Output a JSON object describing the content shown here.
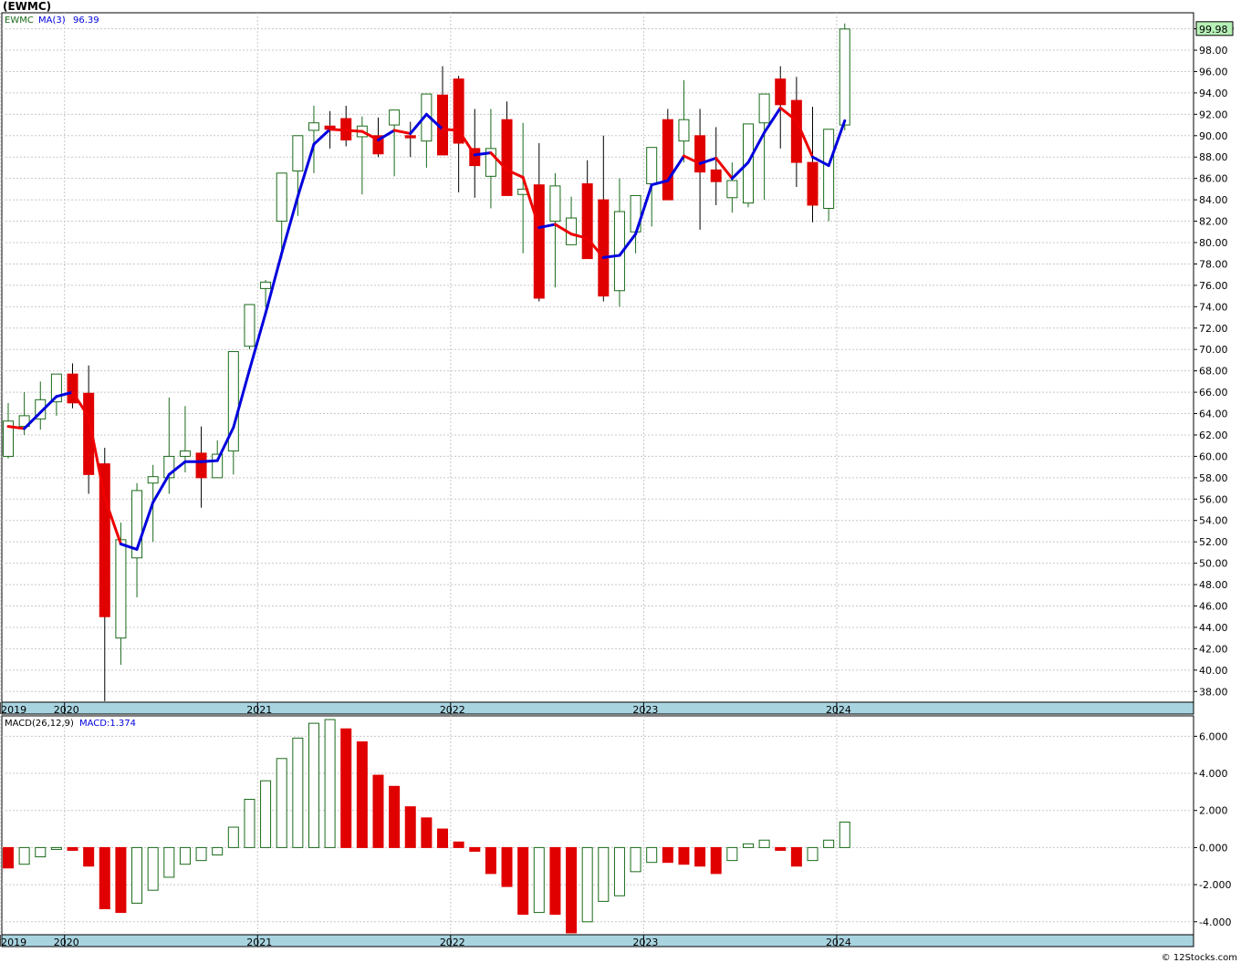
{
  "page": {
    "title": "(EWMC)",
    "credit": "© 12Stocks.com"
  },
  "legend": {
    "symbol": "EWMC",
    "ma_label": "MA(3)",
    "ma_value": "96.39"
  },
  "macd_legend": {
    "name": "MACD(26,12,9)",
    "value_label": "MACD:1.374"
  },
  "colors": {
    "up": "#1a6b1a",
    "down": "#e00000",
    "ma_up": "#0000dd",
    "ma_down": "#ee0000",
    "axis_band": "#a8d4e0",
    "grid": "#c8c8c8",
    "last_price_bg": "#b6f0b6"
  },
  "chart_data": [
    {
      "type": "candlestick",
      "title": "(EWMC)",
      "last_price": "99.98",
      "ylim": [
        37,
        101.5
      ],
      "y_ticks": [
        "38.00",
        "40.00",
        "42.00",
        "44.00",
        "46.00",
        "48.00",
        "50.00",
        "52.00",
        "54.00",
        "56.00",
        "58.00",
        "60.00",
        "62.00",
        "64.00",
        "66.00",
        "68.00",
        "70.00",
        "72.00",
        "74.00",
        "76.00",
        "78.00",
        "80.00",
        "82.00",
        "84.00",
        "86.00",
        "88.00",
        "90.00",
        "92.00",
        "94.00",
        "96.00",
        "98.00",
        "100.00"
      ],
      "x_labels": [
        {
          "label": "2019",
          "index": -0.5
        },
        {
          "label": "2020",
          "index": 3.5
        },
        {
          "label": "2021",
          "index": 15.5
        },
        {
          "label": "2022",
          "index": 27.5
        },
        {
          "label": "2023",
          "index": 39.5
        },
        {
          "label": "2024",
          "index": 51.5
        }
      ],
      "x": [
        "2019-09",
        "2019-10",
        "2019-11",
        "2019-12",
        "2020-01",
        "2020-02",
        "2020-03",
        "2020-04",
        "2020-05",
        "2020-06",
        "2020-07",
        "2020-08",
        "2020-09",
        "2020-10",
        "2020-11",
        "2020-12",
        "2021-01",
        "2021-02",
        "2021-03",
        "2021-04",
        "2021-05",
        "2021-06",
        "2021-07",
        "2021-08",
        "2021-09",
        "2021-10",
        "2021-11",
        "2021-12",
        "2022-01",
        "2022-02",
        "2022-03",
        "2022-04",
        "2022-05",
        "2022-06",
        "2022-07",
        "2022-08",
        "2022-09",
        "2022-10",
        "2022-11",
        "2022-12",
        "2023-01",
        "2023-02",
        "2023-03",
        "2023-04",
        "2023-05",
        "2023-06",
        "2023-07",
        "2023-08",
        "2023-09",
        "2023-10",
        "2023-11",
        "2023-12",
        "2024-01"
      ],
      "open": [
        60.0,
        62.8,
        63.5,
        65.1,
        67.7,
        65.9,
        59.3,
        43.0,
        50.5,
        57.5,
        58.0,
        60.0,
        60.3,
        58.0,
        60.5,
        70.3,
        75.7,
        82.0,
        86.7,
        90.5,
        90.9,
        91.6,
        89.9,
        90.0,
        91.0,
        90.0,
        89.5,
        93.8,
        95.3,
        88.8,
        86.2,
        91.5,
        84.5,
        85.4,
        82.0,
        79.8,
        85.5,
        84.0,
        75.5,
        81.0,
        85.5,
        91.5,
        89.5,
        90.0,
        86.8,
        84.2,
        83.7,
        91.2,
        95.3,
        93.3,
        87.5,
        83.2,
        91.0
      ],
      "high": [
        65.0,
        66.0,
        67.0,
        67.5,
        68.7,
        68.5,
        60.8,
        53.8,
        57.5,
        59.2,
        65.5,
        64.7,
        62.8,
        61.5,
        64.0,
        71.0,
        76.5,
        82.5,
        88.0,
        92.8,
        92.3,
        92.8,
        91.8,
        91.7,
        92.0,
        91.3,
        92.3,
        96.5,
        95.6,
        92.5,
        92.5,
        93.2,
        91.2,
        89.3,
        86.5,
        84.3,
        87.7,
        90.0,
        86.0,
        83.0,
        88.5,
        92.5,
        95.2,
        92.5,
        90.8,
        87.5,
        86.8,
        92.0,
        96.5,
        95.5,
        92.7,
        88.5,
        100.5
      ],
      "low": [
        59.8,
        62.0,
        62.5,
        63.8,
        64.5,
        56.5,
        37.1,
        40.5,
        46.8,
        52.0,
        56.5,
        58.5,
        55.2,
        58.0,
        58.3,
        70.0,
        74.0,
        78.5,
        82.5,
        86.5,
        88.8,
        89.0,
        84.5,
        88.0,
        86.2,
        88.0,
        87.0,
        89.2,
        84.7,
        84.2,
        83.2,
        88.0,
        79.0,
        74.5,
        75.8,
        80.0,
        82.0,
        74.5,
        74.0,
        79.0,
        81.5,
        84.0,
        87.5,
        81.2,
        83.5,
        82.8,
        83.3,
        84.0,
        88.8,
        85.2,
        81.9,
        82.0,
        90.5
      ],
      "close": [
        63.3,
        63.8,
        65.3,
        67.7,
        65.0,
        58.3,
        45.0,
        52.2,
        56.8,
        58.1,
        60.0,
        60.5,
        58.0,
        60.2,
        69.8,
        74.2,
        76.3,
        86.5,
        90.0,
        91.2,
        90.6,
        89.6,
        90.9,
        88.3,
        92.4,
        89.8,
        93.9,
        88.2,
        89.3,
        87.2,
        88.8,
        84.4,
        85.0,
        74.8,
        85.3,
        82.3,
        78.5,
        75.0,
        82.9,
        84.4,
        88.9,
        84.0,
        91.5,
        86.6,
        85.7,
        85.8,
        91.1,
        93.9,
        92.9,
        87.5,
        83.5,
        90.6,
        99.98
      ],
      "ma3": [
        62.8,
        62.6,
        64.1,
        65.6,
        66.0,
        63.7,
        56.1,
        51.8,
        51.3,
        55.7,
        58.3,
        59.5,
        59.5,
        59.6,
        62.7,
        68.1,
        73.4,
        79.0,
        84.3,
        89.2,
        90.6,
        90.5,
        90.4,
        89.6,
        90.5,
        90.2,
        92.0,
        90.6,
        90.5,
        88.2,
        88.4,
        86.8,
        86.1,
        81.4,
        81.7,
        80.8,
        80.4,
        78.6,
        78.8,
        80.8,
        85.4,
        85.8,
        88.1,
        87.4,
        87.9,
        86.0,
        87.5,
        90.3,
        92.6,
        91.4,
        88.0,
        87.2,
        91.4
      ],
      "ma_dir": [
        "d",
        "d",
        "u",
        "u",
        "u",
        "d",
        "d",
        "d",
        "u",
        "u",
        "u",
        "u",
        "u",
        "u",
        "u",
        "u",
        "u",
        "u",
        "u",
        "u",
        "u",
        "d",
        "d",
        "d",
        "u",
        "d",
        "u",
        "u",
        "d",
        "d",
        "u",
        "d",
        "d",
        "d",
        "u",
        "d",
        "d",
        "d",
        "u",
        "u",
        "u",
        "u",
        "u",
        "d",
        "u",
        "d",
        "u",
        "u",
        "u",
        "d",
        "d",
        "u",
        "u"
      ]
    },
    {
      "type": "bar",
      "title": "MACD(26,12,9)",
      "ylim": [
        -4.7,
        7.1
      ],
      "y_ticks": [
        "-4.000",
        "-2.000",
        "0.000",
        "2.000",
        "4.000",
        "6.000"
      ],
      "x_labels": [
        {
          "label": "2019",
          "index": -0.5
        },
        {
          "label": "2020",
          "index": 3.5
        },
        {
          "label": "2021",
          "index": 15.5
        },
        {
          "label": "2022",
          "index": 27.5
        },
        {
          "label": "2023",
          "index": 39.5
        },
        {
          "label": "2024",
          "index": 51.5
        }
      ],
      "values": [
        -1.1,
        -0.9,
        -0.5,
        -0.1,
        -0.15,
        -1.0,
        -3.3,
        -3.5,
        -3.0,
        -2.3,
        -1.6,
        -0.9,
        -0.7,
        -0.4,
        1.1,
        2.6,
        3.6,
        4.8,
        5.9,
        6.7,
        6.9,
        6.4,
        5.7,
        3.9,
        3.3,
        2.2,
        1.6,
        1.0,
        0.3,
        -0.2,
        -1.4,
        -2.1,
        -3.6,
        -3.5,
        -3.6,
        -4.6,
        -4.0,
        -2.9,
        -2.6,
        -1.3,
        -0.8,
        -0.8,
        -0.9,
        -1.0,
        -1.4,
        -0.7,
        0.2,
        0.4,
        -0.15,
        -1.0,
        -0.7,
        0.4,
        1.374
      ],
      "dir": [
        "d",
        "u",
        "u",
        "u",
        "d",
        "d",
        "d",
        "d",
        "u",
        "u",
        "u",
        "u",
        "u",
        "u",
        "u",
        "u",
        "u",
        "u",
        "u",
        "u",
        "u",
        "d",
        "d",
        "d",
        "d",
        "d",
        "d",
        "d",
        "d",
        "d",
        "d",
        "d",
        "d",
        "u",
        "d",
        "d",
        "u",
        "u",
        "u",
        "u",
        "u",
        "d",
        "d",
        "d",
        "d",
        "u",
        "u",
        "u",
        "d",
        "d",
        "u",
        "u",
        "u"
      ]
    }
  ]
}
